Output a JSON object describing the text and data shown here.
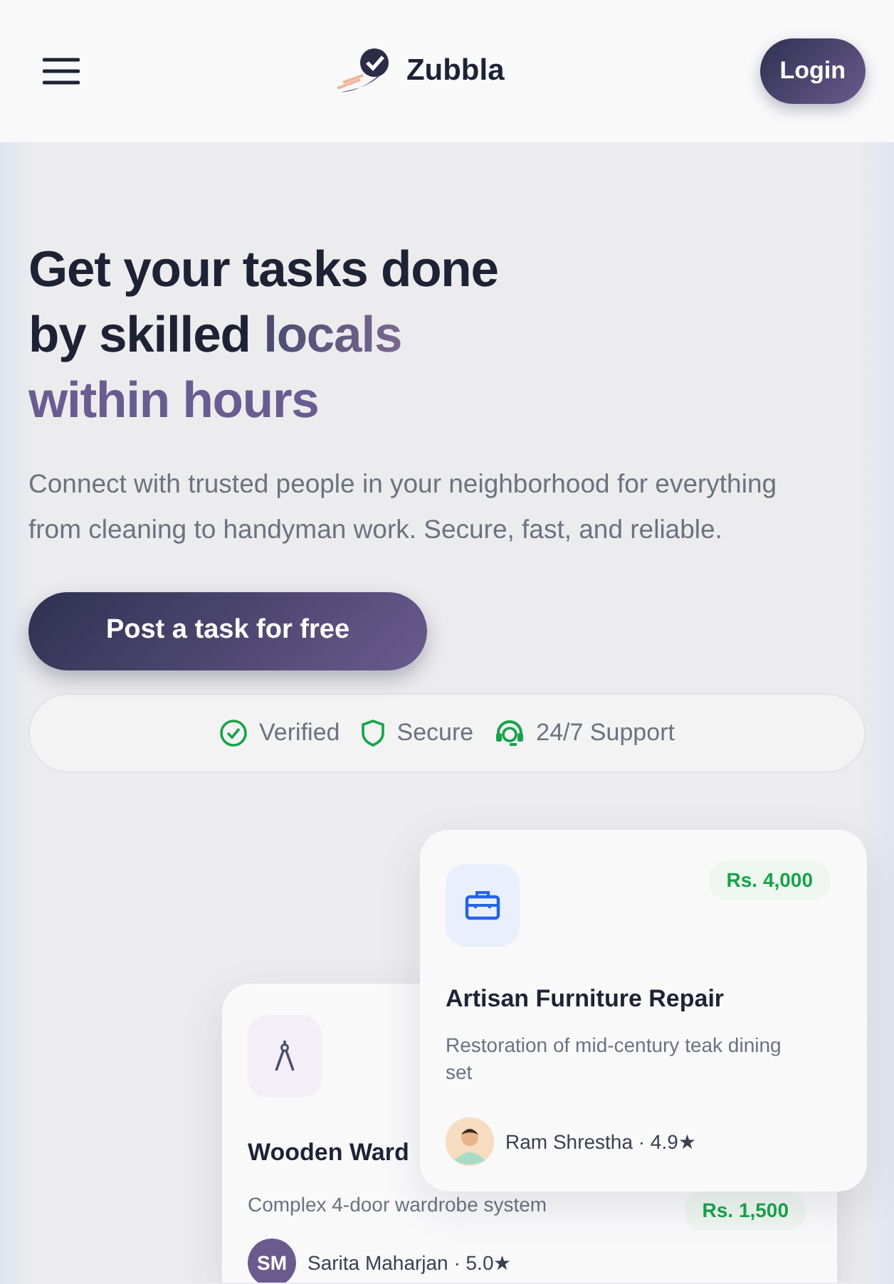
{
  "header": {
    "brand": "Zubbla",
    "login": "Login"
  },
  "hero": {
    "headline": [
      {
        "text": "Get your tasks done",
        "accent": false
      },
      {
        "text": "by skilled ",
        "accent": false
      },
      {
        "text": "locals",
        "accent": true
      },
      {
        "text": "within hours",
        "accent": true
      }
    ],
    "description": "Connect with trusted people in your neighborhood for everything from cleaning to handyman work. Secure, fast, and reliable.",
    "cta": "Post a task for free"
  },
  "trust": [
    {
      "kind": "verified",
      "label": "Verified"
    },
    {
      "kind": "secure",
      "label": "Secure"
    },
    {
      "kind": "support",
      "label": "24/7 Support"
    }
  ],
  "task_cards": [
    {
      "kind": "toolbox",
      "title": "Artisan Furniture Repair",
      "description": "Restoration of mid-century teak dining set",
      "price": "Rs. 4,000",
      "avatar": {
        "kind": "person"
      },
      "person": "Ram Shrestha · 4.9★"
    },
    {
      "kind": "compass",
      "title": "Wooden Ward",
      "description": "Complex 4-door wardrobe system",
      "price": "Rs. 1,500",
      "avatar": {
        "kind": "initials",
        "text": "SM"
      },
      "person": "Sarita Maharjan · 5.0★"
    }
  ]
}
